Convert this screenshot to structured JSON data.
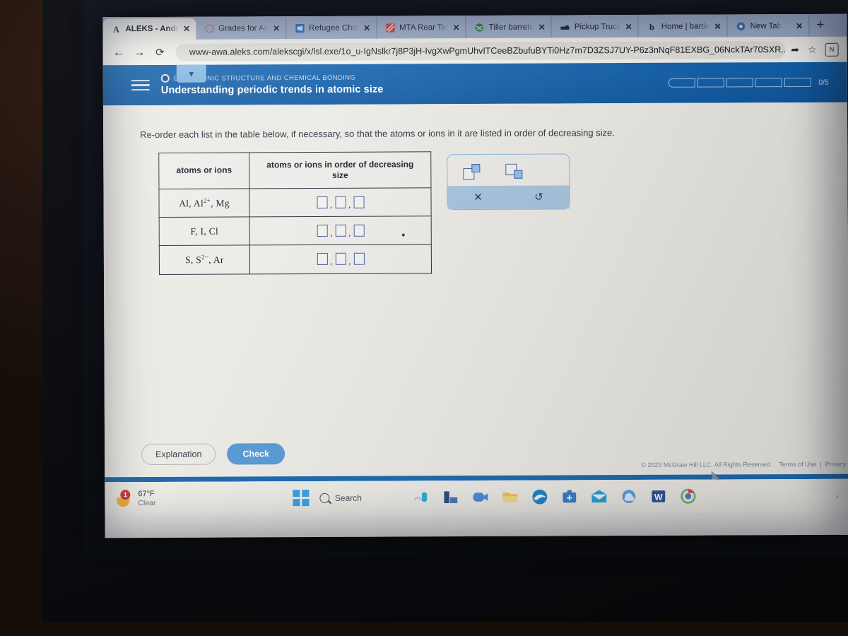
{
  "browser": {
    "tabs": [
      {
        "title": "ALEKS - Andr",
        "favicon": "aleks-a-icon",
        "active": true,
        "close": "✕"
      },
      {
        "title": "Grades for An",
        "favicon": "canvas-circle-icon",
        "active": false,
        "close": "✕"
      },
      {
        "title": "Refugee Chor",
        "favicon": "blue-square-icon",
        "active": false,
        "close": "✕"
      },
      {
        "title": "MTA Rear Tin",
        "favicon": "red-pattern-icon",
        "active": false,
        "close": "✕"
      },
      {
        "title": "Tiller barreto",
        "favicon": "globe-icon",
        "active": false,
        "close": "✕"
      },
      {
        "title": "Pickup Truck",
        "favicon": "truck-icon",
        "active": false,
        "close": "✕"
      },
      {
        "title": "Home | bartle",
        "favicon": "bartleby-b-icon",
        "active": false,
        "close": "✕"
      },
      {
        "title": "New Tab",
        "favicon": "chrome-icon",
        "active": false,
        "close": "✕"
      }
    ],
    "new_tab_label": "+",
    "nav": {
      "back": "←",
      "forward": "→",
      "reload": "⟳"
    },
    "url": "www-awa.aleks.com/alekscgi/x/lsl.exe/1o_u-IgNslkr7j8P3jH-IvgXwPgmUhvITCeeBZbufuBYTi0Hz7m7D3ZSJ7UY-P6z3nNqF81EXBG_06NckTAr70SXR...",
    "lock_icon": "lock-icon",
    "share_icon": "share-icon",
    "bookmark_icon": "star-icon",
    "profile_initial": "N"
  },
  "aleks": {
    "kicker": "ELECTRONIC STRUCTURE AND CHEMICAL BONDING",
    "title": "Understanding periodic trends in atomic size",
    "progress": {
      "segments": 5,
      "filled": 0,
      "label": "0/5"
    },
    "menu_icon": "hamburger-menu-icon",
    "subtab_icon": "chevron-down-icon",
    "prompt": "Re-order each list in the table below, if necessary, so that the atoms or ions in it are listed in order of decreasing size.",
    "table": {
      "headers": [
        "atoms or ions",
        "atoms or ions in order of decreasing size"
      ],
      "rows": [
        {
          "species": "Al, Al²⁺, Mg",
          "species_parts": [
            {
              "t": "Al, Al",
              "sup": ""
            },
            {
              "t": "",
              "sup": "2+"
            },
            {
              "t": ", Mg",
              "sup": ""
            }
          ],
          "answer": [
            "",
            "",
            ""
          ]
        },
        {
          "species": "F, I, Cl",
          "species_parts": [
            {
              "t": "F, I, Cl",
              "sup": ""
            }
          ],
          "answer": [
            "",
            "",
            ""
          ]
        },
        {
          "species": "S, S²⁻, Ar",
          "species_parts": [
            {
              "t": "S, S",
              "sup": ""
            },
            {
              "t": "",
              "sup": "2−"
            },
            {
              "t": ", Ar",
              "sup": ""
            }
          ],
          "answer": [
            "",
            "",
            ""
          ]
        }
      ]
    },
    "palette": {
      "superscript_icon": "superscript-icon",
      "subscript_icon": "subscript-icon",
      "clear_label": "✕",
      "undo_label": "↺"
    },
    "buttons": {
      "explanation": "Explanation",
      "check": "Check"
    },
    "footer": {
      "copyright": "© 2023 McGraw Hill LLC. All Rights Reserved.",
      "terms": "Terms of Use",
      "separator": "|",
      "privacy": "Privacy"
    }
  },
  "taskbar": {
    "weather": {
      "temp": "67°F",
      "condition": "Clear",
      "badge": "1",
      "icon": "sun-cloud-icon"
    },
    "start_icon": "windows-start-icon",
    "search_label": "Search",
    "search_icon": "search-icon",
    "apps": [
      {
        "name": "copilot-icon",
        "color": "#8fb5dd"
      },
      {
        "name": "widgets-icon",
        "color": "#3c5a8a"
      },
      {
        "name": "zoom-icon",
        "color": "#4a8ce0"
      },
      {
        "name": "file-explorer-icon",
        "color": "#efc15c"
      },
      {
        "name": "edge-icon",
        "color": "#1e88c8"
      },
      {
        "name": "store-icon",
        "color": "#3b7ecb"
      },
      {
        "name": "mail-icon",
        "color": "#2aa3d8"
      },
      {
        "name": "onedrive-icon",
        "color": "#5aa0e6"
      },
      {
        "name": "word-icon",
        "color": "#2b5797"
      },
      {
        "name": "chrome-icon",
        "color": "#e8e8e8"
      }
    ],
    "overflow": "^"
  },
  "colors": {
    "aleks_blue": "#1463ae",
    "check_blue": "#5b9bd5",
    "input_border": "#4a63a8",
    "page_bg": "#eceae5"
  }
}
